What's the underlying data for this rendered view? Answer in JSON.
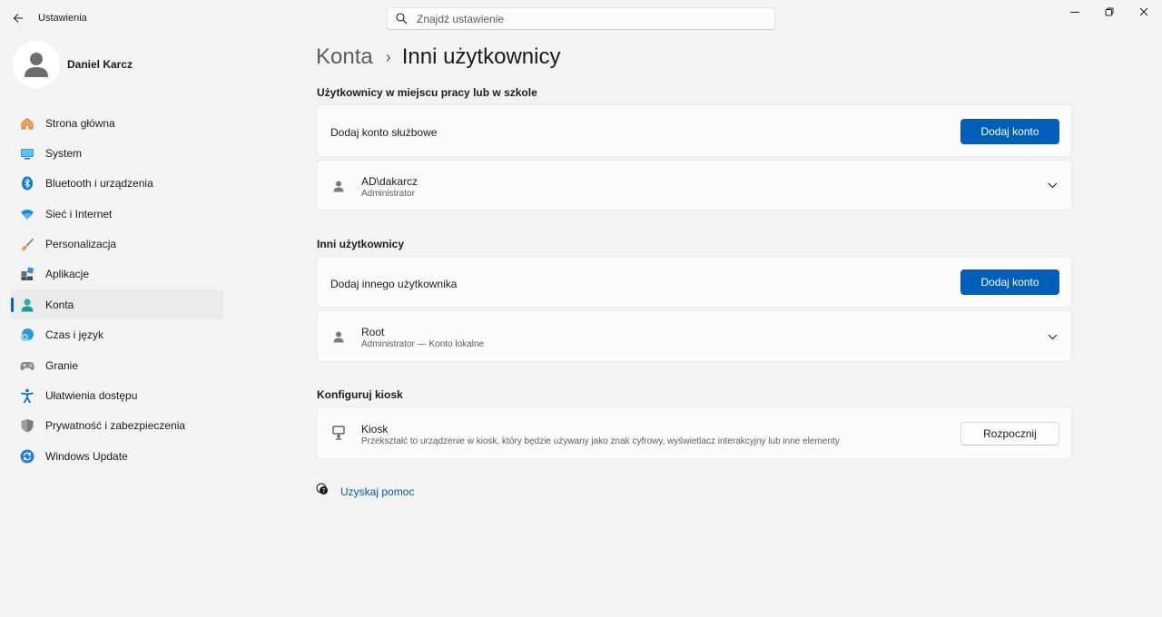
{
  "app": {
    "title": "Ustawienia"
  },
  "search": {
    "placeholder": "Znajdź ustawienie"
  },
  "profile": {
    "name": "Daniel Karcz"
  },
  "sidebar": {
    "items": [
      {
        "label": "Strona główna",
        "icon": "home-icon"
      },
      {
        "label": "System",
        "icon": "system-icon"
      },
      {
        "label": "Bluetooth i urządzenia",
        "icon": "bluetooth-icon"
      },
      {
        "label": "Sieć i Internet",
        "icon": "wifi-icon"
      },
      {
        "label": "Personalizacja",
        "icon": "brush-icon"
      },
      {
        "label": "Aplikacje",
        "icon": "apps-icon"
      },
      {
        "label": "Konta",
        "icon": "accounts-icon",
        "active": true
      },
      {
        "label": "Czas i język",
        "icon": "time-language-icon"
      },
      {
        "label": "Granie",
        "icon": "gamepad-icon"
      },
      {
        "label": "Ułatwienia dostępu",
        "icon": "accessibility-icon"
      },
      {
        "label": "Prywatność i zabezpieczenia",
        "icon": "shield-icon"
      },
      {
        "label": "Windows Update",
        "icon": "update-icon"
      }
    ]
  },
  "breadcrumb": {
    "parent": "Konta",
    "separator": "›",
    "current": "Inni użytkownicy"
  },
  "work": {
    "title": "Użytkownicy w miejscu pracy lub w szkole",
    "add_label": "Dodaj konto służbowe",
    "add_button": "Dodaj konto",
    "user": {
      "name": "AD\\dakarcz",
      "role": "Administrator"
    }
  },
  "others": {
    "title": "Inni użytkownicy",
    "add_label": "Dodaj innego użytkownika",
    "add_button": "Dodaj konto",
    "user": {
      "name": "Root",
      "role": "Administrator — Konto lokalne"
    }
  },
  "kiosk": {
    "title": "Konfiguruj kiosk",
    "name": "Kiosk",
    "description": "Przekształć to urządzenie w kiosk, który będzie używany jako znak cyfrowy, wyświetlacz interakcyjny lub inne elementy",
    "button": "Rozpocznij"
  },
  "help": {
    "label": "Uzyskaj pomoc"
  },
  "colors": {
    "accent": "#005fb8",
    "background": "#f3f3f3",
    "card": "#fbfbfb",
    "link": "#005a9e"
  }
}
